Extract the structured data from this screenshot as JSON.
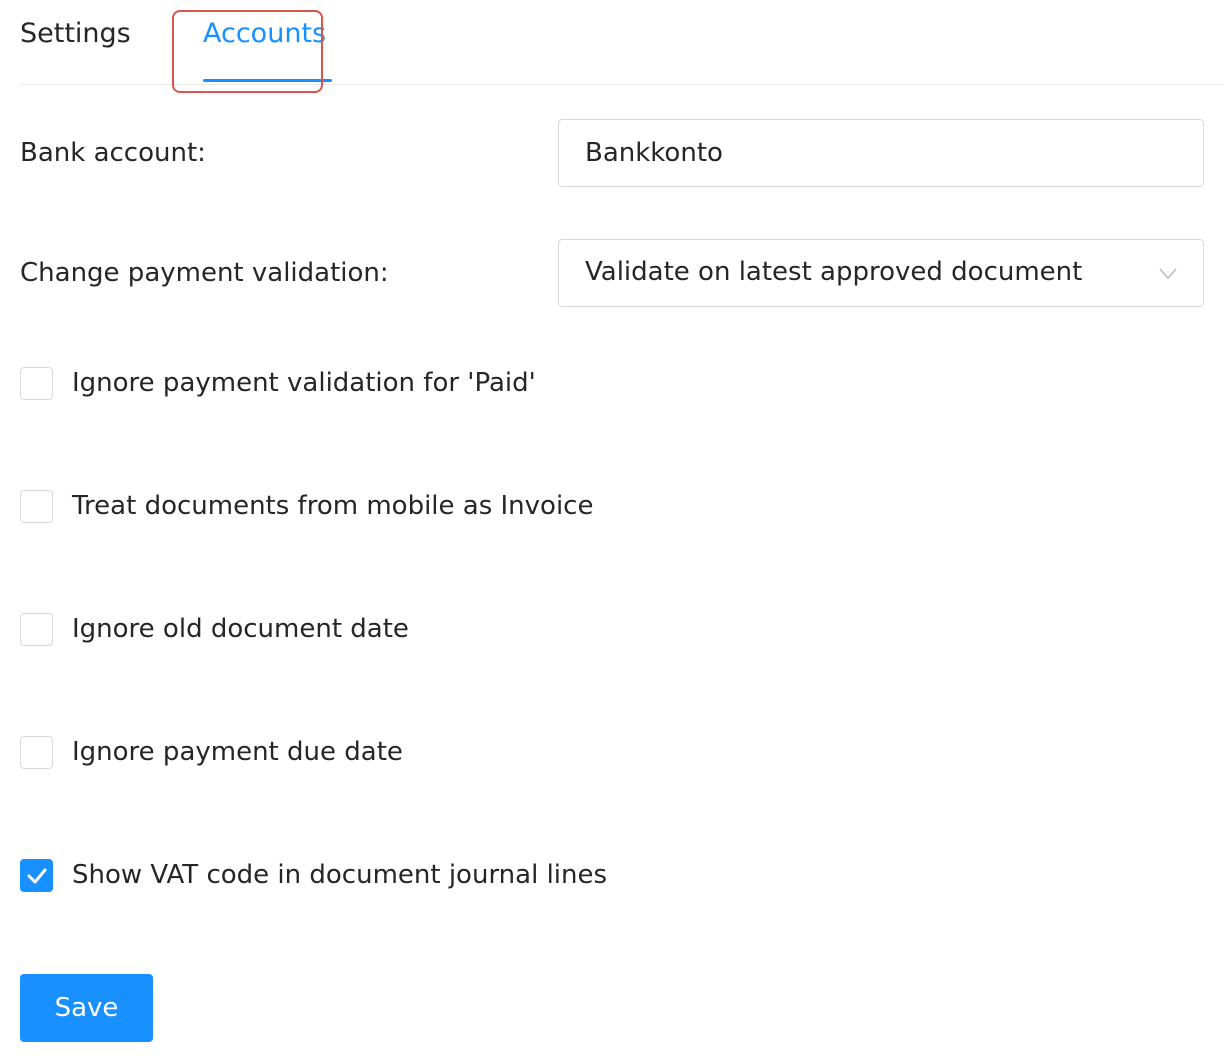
{
  "tabs": {
    "items": [
      {
        "label": "Settings",
        "active": false
      },
      {
        "label": "Accounts",
        "active": true
      }
    ],
    "accent_color": "#1890ff",
    "highlight_color": "#d9534f"
  },
  "form": {
    "bank_account": {
      "label": "Bank account:",
      "value": "Bankkonto"
    },
    "payment_validation": {
      "label": "Change payment validation:",
      "selected": "Validate on latest approved document"
    },
    "checkboxes": [
      {
        "label": "Ignore payment validation for 'Paid'",
        "checked": false
      },
      {
        "label": "Treat documents from mobile as Invoice",
        "checked": false
      },
      {
        "label": "Ignore old document date",
        "checked": false
      },
      {
        "label": "Ignore payment due date",
        "checked": false
      },
      {
        "label": "Show VAT code in document journal lines",
        "checked": true
      }
    ]
  },
  "actions": {
    "save_label": "Save"
  }
}
